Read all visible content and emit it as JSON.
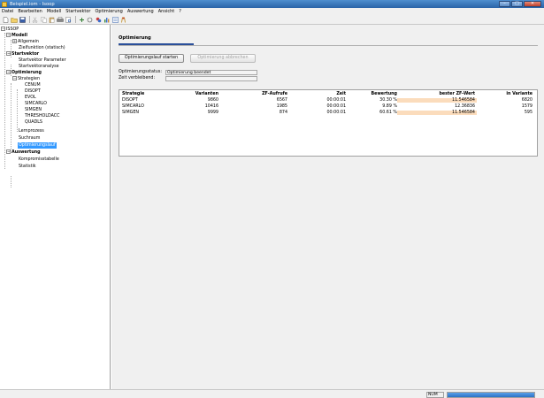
{
  "window": {
    "title": "Beispiel.iom - Isoop",
    "minimize": "–",
    "maximize": "□",
    "close": "✕"
  },
  "menu": [
    "Datei",
    "Bearbeiten",
    "Modell",
    "Startvektor",
    "Optimierung",
    "Auswertung",
    "Ansicht",
    "?"
  ],
  "toolbar": {
    "icons": [
      "new-icon",
      "open-icon",
      "save-icon",
      "cut-icon",
      "copy-icon",
      "paste-icon",
      "print-icon",
      "print-preview-icon",
      "run-icon",
      "stop-icon",
      "tool-icon",
      "chart-icon",
      "settings-icon",
      "help-icon"
    ]
  },
  "tree": {
    "root": "ISSOP",
    "modell": "Modell",
    "allgemein": "Allgemein",
    "zielfunktion": "Zielfunktion (statisch)",
    "startvektor": "Startvektor",
    "startvektor_parameter": "Startvektor Parameter",
    "startvektoranalyse": "Startvektoranalyse",
    "optimierung": "Optimierung",
    "strategien": "Strategien",
    "strategies": [
      "CENUM",
      "DISOPT",
      "EVOL",
      "SIMCARLO",
      "SIMGEN",
      "THRESHOLDACC",
      "QUADLS"
    ],
    "lernprozess": "Lernprozess",
    "suchraum": "Suchraum",
    "optimierungslauf": "Optimierungslauf",
    "auswertung": "Auswertung",
    "kompromisstabelle": "Kompromisstabelle",
    "statistik": "Statistik"
  },
  "panel": {
    "title": "Optimierung",
    "start_button": "Optimierungslauf starten",
    "abort_button": "Optimierung abbrechen",
    "status_label": "Optimierungsstatus:",
    "status_value": "Optimierung beendet",
    "remaining_label": "Zeit verbleibend:",
    "remaining_value": ""
  },
  "results": {
    "headers": [
      "Strategie",
      "Varianten",
      "ZF-Aufrufe",
      "Zeit",
      "Bewertung",
      "bester ZF-Wert",
      "in Variante"
    ],
    "rows": [
      [
        "DISOPT",
        "9860",
        "6567",
        "00:00:01",
        "30.30 %",
        "11.546584",
        "6820"
      ],
      [
        "SIMCARLO",
        "10416",
        "1985",
        "00:00:01",
        "9.89 %",
        "12.36836",
        "1579"
      ],
      [
        "SIMGEN",
        "9999",
        "874",
        "00:00:01",
        "60.61 %",
        "11.546584",
        "595"
      ]
    ]
  },
  "statusbar": {
    "num": "NUM",
    "progress": 1.0
  },
  "colors": {
    "selection": "#3399ff",
    "accent_rule": "#2a4f9a",
    "best_value_highlight": "#fbdcbc",
    "progress": "#2c72c6"
  }
}
